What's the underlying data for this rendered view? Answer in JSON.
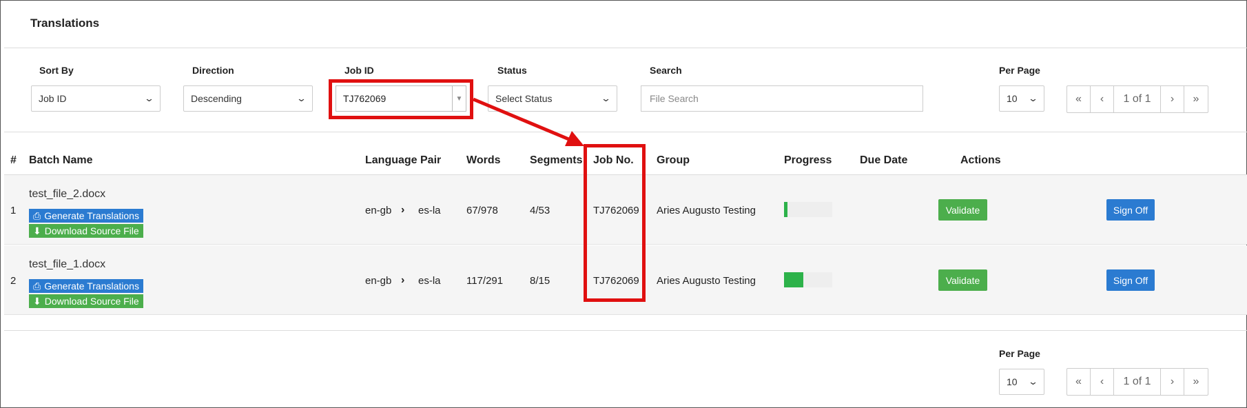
{
  "page": {
    "title": "Translations"
  },
  "filters": {
    "sort_by": {
      "label": "Sort By",
      "value": "Job ID"
    },
    "direction": {
      "label": "Direction",
      "value": "Descending"
    },
    "job_id": {
      "label": "Job ID",
      "value": "TJ762069"
    },
    "status": {
      "label": "Status",
      "value": "Select Status"
    },
    "search": {
      "label": "Search",
      "placeholder": "File Search"
    },
    "per_page": {
      "label": "Per Page",
      "value": "10"
    }
  },
  "pagination": {
    "first": "«",
    "prev": "‹",
    "info": "1 of 1",
    "next": "›",
    "last": "»"
  },
  "table": {
    "headers": [
      "#",
      "Batch Name",
      "Language Pair",
      "Words",
      "Segments",
      "Job No.",
      "Group",
      "Progress",
      "Due Date",
      "Actions"
    ],
    "generate_label": "Generate Translations",
    "download_label": "Download Source File",
    "validate_label": "Validate",
    "signoff_label": "Sign Off",
    "rows": [
      {
        "num": "1",
        "file": "test_file_2.docx",
        "src": "en-gb",
        "tgt": "es-la",
        "words": "67/978",
        "segments": "4/53",
        "job": "TJ762069",
        "group": "Aries Augusto Testing",
        "due": "",
        "progress": 0.07
      },
      {
        "num": "2",
        "file": "test_file_1.docx",
        "src": "en-gb",
        "tgt": "es-la",
        "words": "117/291",
        "segments": "8/15",
        "job": "TJ762069",
        "group": "Aries Augusto Testing",
        "due": "",
        "progress": 0.4
      }
    ]
  },
  "colors": {
    "highlight": "#e01010",
    "primary": "#2b7bd1",
    "success": "#4cae4c",
    "progress": "#2db24a"
  },
  "icons": {
    "print": "print-icon",
    "download": "download-icon",
    "chevron": "chevron-right-icon"
  }
}
